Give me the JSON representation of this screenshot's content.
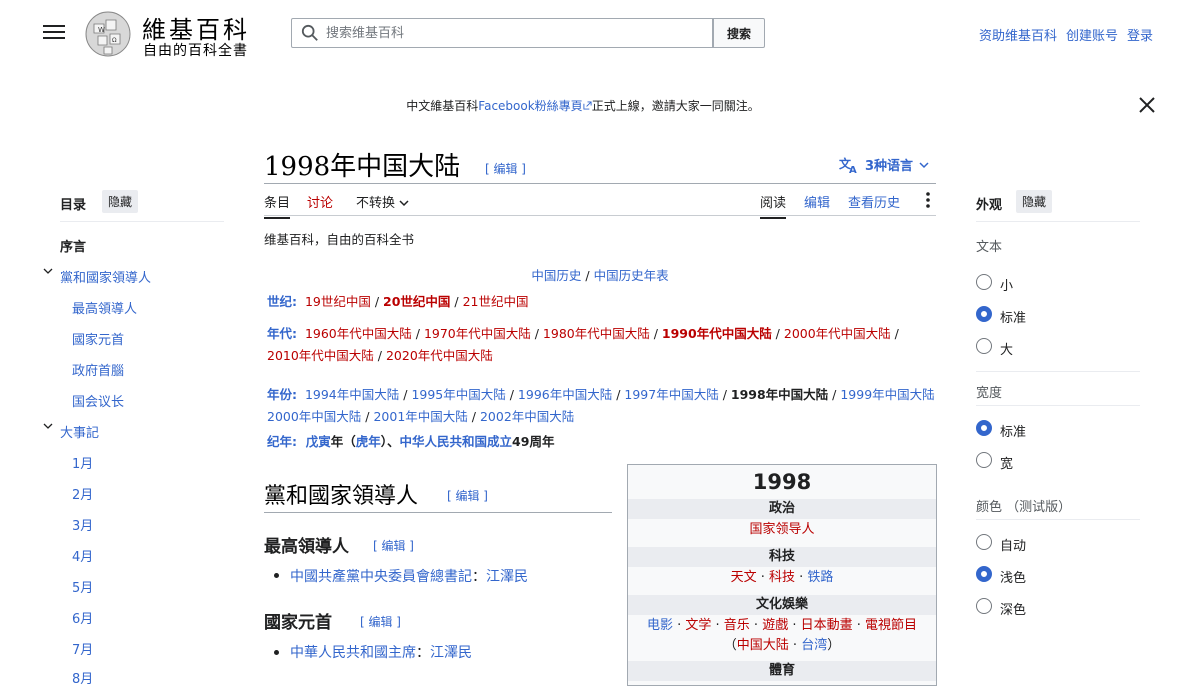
{
  "header": {
    "logo_title": "維基百科",
    "logo_subtitle": "自由的百科全書",
    "search_placeholder": "搜索维基百科",
    "search_button": "搜索",
    "links": [
      "资助维基百科",
      "创建账号",
      "登录"
    ]
  },
  "notice": {
    "prefix": "中文維基百科",
    "link": "Facebook粉絲專頁",
    "suffix": "正式上線，邀請大家一同關注。"
  },
  "article": {
    "title": "1998年中国大陆",
    "edit_label": "[ 编辑 ]",
    "languages": "3种语言",
    "tabs": {
      "article": "条目",
      "talk": "讨论",
      "variant": "不转换",
      "read": "阅读",
      "edit": "编辑",
      "history": "查看历史"
    },
    "tagline": "维基百科，自由的百科全书"
  },
  "navbox": {
    "top_a": "中国历史",
    "top_b": "中国历史年表",
    "century_label": "世纪:",
    "centuries": [
      "19世纪中国",
      "20世纪中国",
      "21世纪中国"
    ],
    "decade_label": "年代:",
    "decades": [
      "1960年代中国大陆",
      "1970年代中国大陆",
      "1980年代中国大陆",
      "1990年代中国大陆",
      "2000年代中国大陆",
      "2010年代中国大陆",
      "2020年代中国大陆"
    ],
    "year_label": "年份:",
    "years": [
      "1994年中国大陆",
      "1995年中国大陆",
      "1996年中国大陆",
      "1997年中国大陆",
      "1998年中国大陆",
      "1999年中国大陆",
      "2000年中国大陆",
      "2001年中国大陆",
      "2002年中国大陆"
    ],
    "era_label": "纪年:",
    "era_1_link": "戊寅",
    "era_1_year": "年（",
    "era_1_animal": "虎年",
    "era_1_close": "）、",
    "era_2_link": "中华人民共和国成立",
    "era_2_years": "49周年"
  },
  "sections": {
    "leaders": "黨和國家領導人",
    "supreme": "最高領導人",
    "supreme_item_link": "中國共產黨中央委員會總書記",
    "supreme_item_sep": "：",
    "supreme_item_name": "江澤民",
    "head": "國家元首",
    "head_item_link": "中華人民共和國主席",
    "head_item_sep": "：",
    "head_item_name": "江澤民"
  },
  "infobox": {
    "year": "1998",
    "politics": "政治",
    "politics_item": "国家领导人",
    "tech": "科技",
    "tech_items": [
      "天文",
      "科技",
      "铁路"
    ],
    "culture": "文化娛樂",
    "culture_items": [
      "电影",
      "文学",
      "音乐",
      "遊戲",
      "日本動畫",
      "電視節目"
    ],
    "culture_sub": [
      "中国大陆",
      "台湾"
    ],
    "sport_partial": "體育"
  },
  "toc": {
    "title": "目录",
    "hide": "隐藏",
    "items": [
      "序言",
      "黨和國家領導人",
      "最高領導人",
      "國家元首",
      "政府首腦",
      "国会议长",
      "大事記",
      "1月",
      "2月",
      "3月",
      "4月",
      "5月",
      "6月",
      "7月",
      "8月"
    ]
  },
  "appearance": {
    "title": "外观",
    "hide": "隐藏",
    "text_label": "文本",
    "text_options": [
      "小",
      "标准",
      "大"
    ],
    "text_selected": "标准",
    "width_label": "宽度",
    "width_options": [
      "标准",
      "宽"
    ],
    "width_selected": "标准",
    "color_label": "颜色 （测试版）",
    "color_options": [
      "自动",
      "浅色",
      "深色"
    ],
    "color_selected": "浅色"
  },
  "colors": {
    "link": "#3366cc",
    "redlink": "#ba0000",
    "text": "#202122"
  }
}
